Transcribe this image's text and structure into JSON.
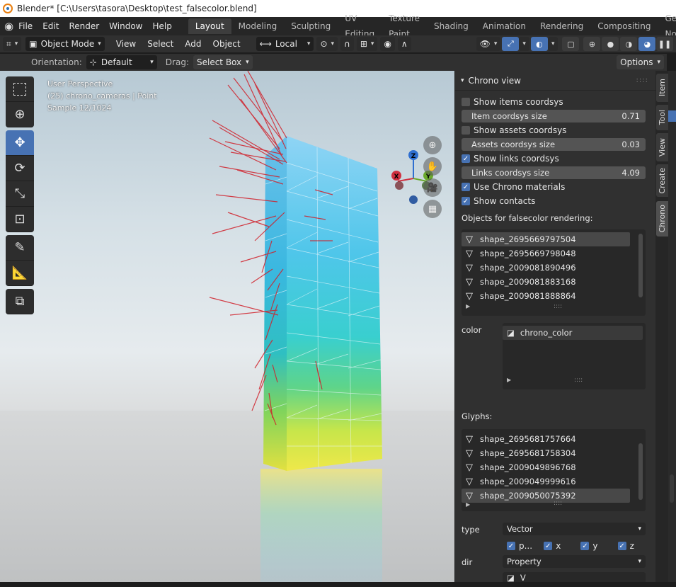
{
  "window": {
    "title": "Blender* [C:\\Users\\tasora\\Desktop\\test_falsecolor.blend]"
  },
  "menu": [
    "File",
    "Edit",
    "Render",
    "Window",
    "Help"
  ],
  "workspaces": [
    "Layout",
    "Modeling",
    "Sculpting",
    "UV Editing",
    "Texture Paint",
    "Shading",
    "Animation",
    "Rendering",
    "Compositing",
    "Geometry No"
  ],
  "header": {
    "mode": "Object Mode",
    "view": "View",
    "select": "Select",
    "add": "Add",
    "object": "Object",
    "transform_orientation": "Local"
  },
  "tool_settings": {
    "orientation_label": "Orientation:",
    "orientation_value": "Default",
    "drag_label": "Drag:",
    "drag_value": "Select Box",
    "options": "Options"
  },
  "viewport": {
    "perspective": "User Perspective",
    "object_info": "(25) chrono_cameras | Point",
    "sample": "Sample 12/1024"
  },
  "gizmo": {
    "z": "Z",
    "x": "X",
    "y": "Y"
  },
  "panel": {
    "title": "Chrono view",
    "show_items_coordsys": {
      "label": "Show items coordsys",
      "checked": false
    },
    "item_coordsys_size": {
      "label": "Item coordsys size",
      "value": "0.71"
    },
    "show_assets_coordsys": {
      "label": "Show assets coordsys",
      "checked": false
    },
    "assets_coordsys_size": {
      "label": "Assets coordsys size",
      "value": "0.03"
    },
    "show_links_coordsys": {
      "label": "Show links coordsys",
      "checked": true
    },
    "links_coordsys_size": {
      "label": "Links coordsys size",
      "value": "4.09"
    },
    "use_chrono_materials": {
      "label": "Use Chrono materials",
      "checked": true
    },
    "show_contacts": {
      "label": "Show contacts",
      "checked": true
    },
    "objects_label": "Objects for falsecolor rendering:",
    "objects": [
      "shape_2695669797504",
      "shape_2695669798048",
      "shape_2009081890496",
      "shape_2009081883168",
      "shape_2009081888864"
    ],
    "color_label": "color",
    "color_items": [
      "chrono_color"
    ],
    "glyphs_label": "Glyphs:",
    "glyphs": [
      "shape_2695681757664",
      "shape_2695681758304",
      "shape_2009049896768",
      "shape_2009049999616",
      "shape_2009050075392"
    ],
    "type_label": "type",
    "type_value": "Vector",
    "components": [
      {
        "label": "p...",
        "checked": true
      },
      {
        "label": "x",
        "checked": true
      },
      {
        "label": "y",
        "checked": true
      },
      {
        "label": "z",
        "checked": true
      }
    ],
    "dir_label": "dir",
    "dir_value": "Property",
    "dir_item": "V"
  },
  "tabs": [
    "Item",
    "Tool",
    "View",
    "Create",
    "Chrono"
  ],
  "colors": {
    "accent": "#4772b3",
    "panel": "#303030",
    "field": "#545454"
  }
}
